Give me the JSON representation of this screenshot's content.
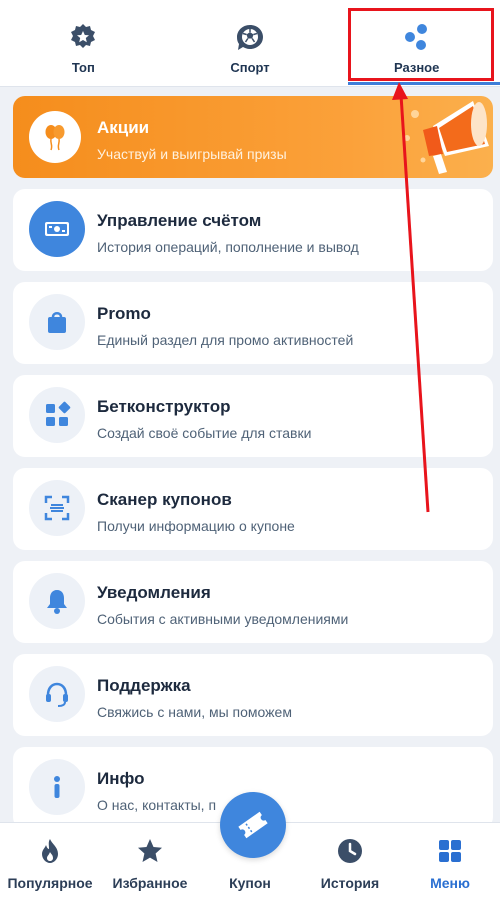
{
  "tabs": [
    {
      "label": "Топ",
      "icon": "star-badge-icon"
    },
    {
      "label": "Спорт",
      "icon": "sport-ball-icon"
    },
    {
      "label": "Разное",
      "icon": "misc-dots-icon",
      "active": true
    }
  ],
  "menu": [
    {
      "title": "Акции",
      "subtitle": "Участвуй и выигрывай призы",
      "icon": "balloons-icon"
    },
    {
      "title": "Управление счётом",
      "subtitle": "История операций, пополнение и вывод",
      "icon": "cash-icon"
    },
    {
      "title": "Promo",
      "subtitle": "Единый раздел для промо активностей",
      "icon": "shopping-bag-icon"
    },
    {
      "title": "Бетконструктор",
      "subtitle": "Создай своё событие для ставки",
      "icon": "blocks-icon"
    },
    {
      "title": "Сканер купонов",
      "subtitle": "Получи информацию о купоне",
      "icon": "scanner-icon"
    },
    {
      "title": "Уведомления",
      "subtitle": "События с активными уведомлениями",
      "icon": "bell-icon"
    },
    {
      "title": "Поддержка",
      "subtitle": "Свяжись с нами, мы поможем",
      "icon": "headset-icon"
    },
    {
      "title": "Инфо",
      "subtitle": "О нас, контакты, п",
      "icon": "info-icon"
    }
  ],
  "bottom_nav": [
    {
      "label": "Популярное",
      "icon": "flame-icon"
    },
    {
      "label": "Избранное",
      "icon": "star-icon"
    },
    {
      "label": "Купон",
      "icon": "ticket-icon"
    },
    {
      "label": "История",
      "icon": "clock-icon"
    },
    {
      "label": "Меню",
      "icon": "grid-icon",
      "active": true
    }
  ],
  "colors": {
    "accent": "#3f86dd",
    "icon_dark": "#1f3552",
    "promo_orange": "#f58d1c",
    "annotation_red": "#e8141c"
  }
}
